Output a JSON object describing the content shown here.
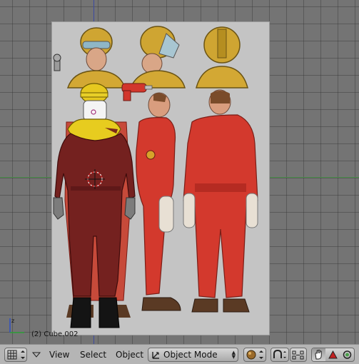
{
  "viewport": {
    "object_label": "(2) Cube.002"
  },
  "header": {
    "menus": {
      "view": "View",
      "select": "Select",
      "object": "Object"
    },
    "mode_select": {
      "value": "Object Mode"
    },
    "icons": {
      "viewport_type": "grid-icon",
      "collapse_menu": "triangle-down-icon",
      "draw_type": "shaded-sphere-icon",
      "pivot": "pivot-icon",
      "snap_view": "view-snap-icon",
      "manipulator_translate": "hand-icon",
      "manipulator_rotate": "triangle-icon",
      "manipulator_scale": "circle-icon"
    }
  },
  "colors": {
    "viewport_bg": "#747474",
    "grid_line": "#5e5e5e",
    "axis_x": "#4b8f4b",
    "axis_y": "#3c4aa0",
    "header_bg": "#b5b5b5",
    "suit_red": "#d3392d",
    "model_maroon": "#731c1c",
    "helmet_yellow": "#d4b21c"
  }
}
